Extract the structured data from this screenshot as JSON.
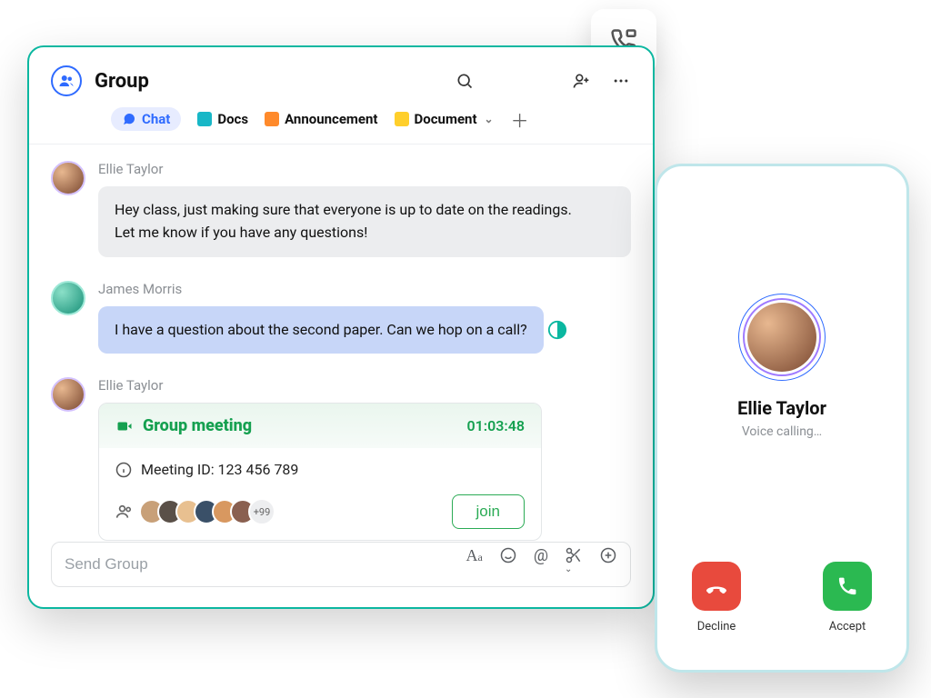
{
  "header": {
    "title": "Group",
    "tabs": [
      {
        "label": "Chat"
      },
      {
        "label": "Docs"
      },
      {
        "label": "Announcement"
      },
      {
        "label": "Document"
      }
    ]
  },
  "messages": [
    {
      "sender": "Ellie Taylor",
      "avatar": "a1",
      "style": "grey",
      "text": "Hey class, just making sure that everyone is up to date on the readings.\n Let me know if you have any questions!"
    },
    {
      "sender": "James Morris",
      "avatar": "a2",
      "style": "blue",
      "text": "I have a question about the second paper. Can we hop on a call?"
    }
  ],
  "meeting": {
    "sender": "Ellie Taylor",
    "title": "Group meeting",
    "timer": "01:03:48",
    "meeting_id_label": "Meeting ID: 123 456 789",
    "more_count": "+99",
    "join_label": "join"
  },
  "composer": {
    "placeholder": "Send Group"
  },
  "phone": {
    "name": "Ellie Taylor",
    "status": "Voice calling…",
    "decline_label": "Decline",
    "accept_label": "Accept"
  }
}
